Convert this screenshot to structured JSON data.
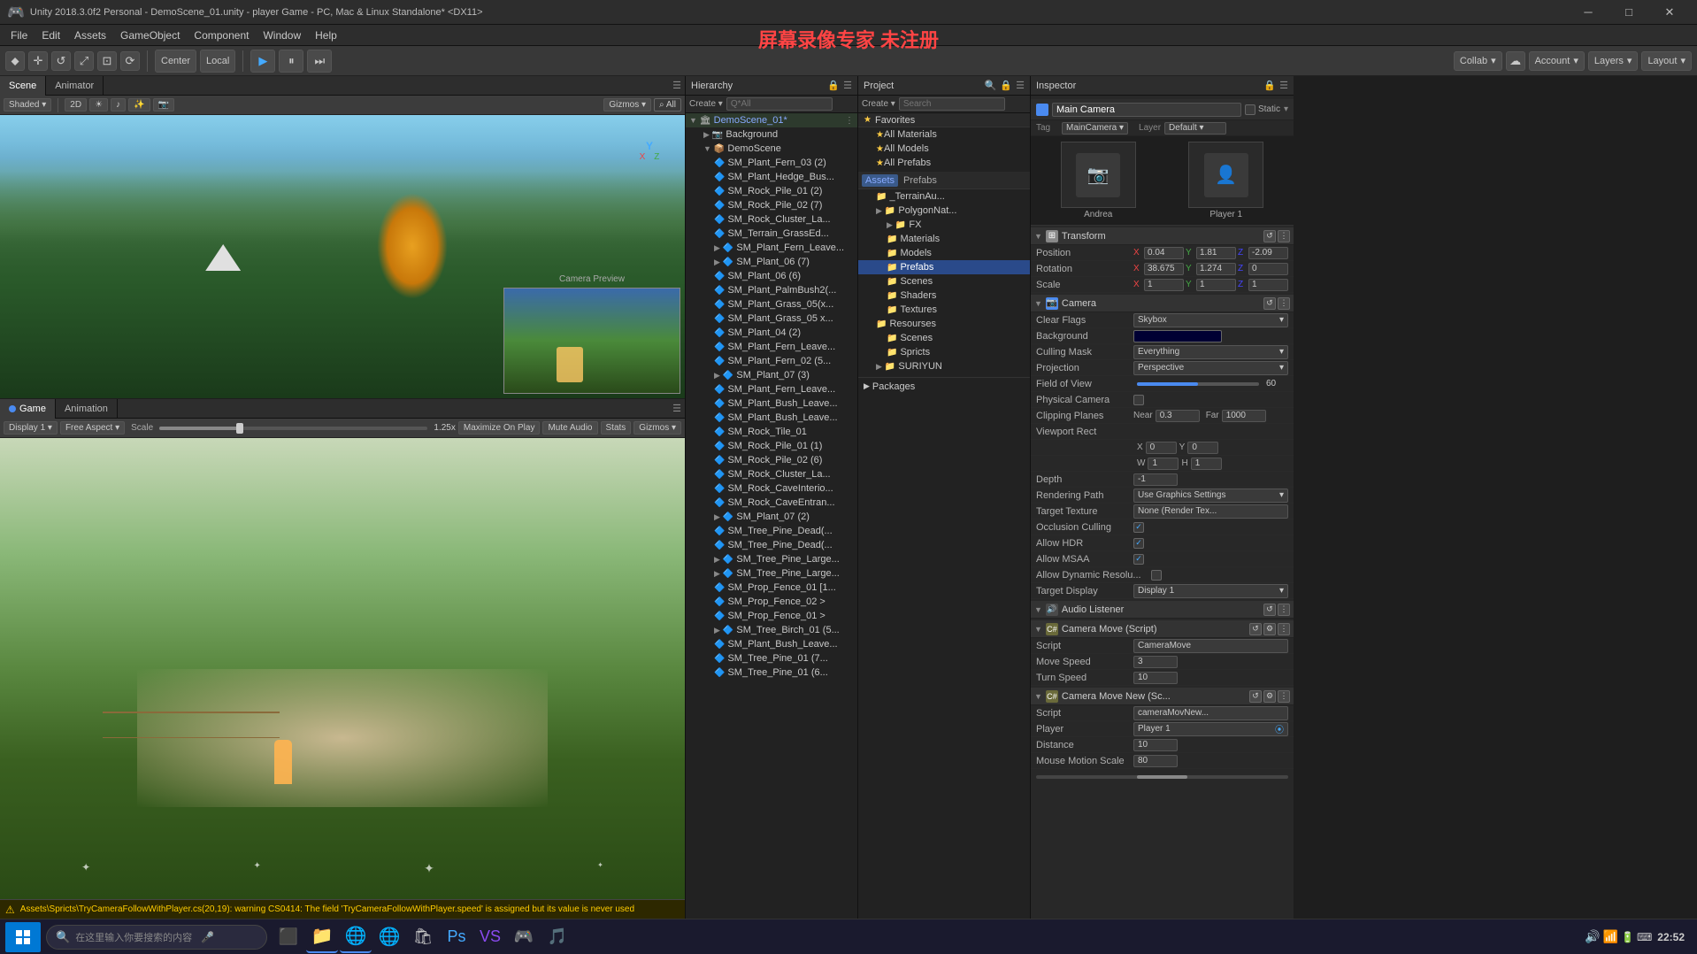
{
  "titlebar": {
    "title": "Unity 2018.3.0f2 Personal - DemoScene_01.unity - player Game - PC, Mac & Linux Standalone* <DX11>",
    "icon": "🎮"
  },
  "watermark": "屏幕录像专家 未注册",
  "menubar": {
    "items": [
      "File",
      "Edit",
      "Assets",
      "GameObject",
      "Component",
      "Window",
      "Help"
    ]
  },
  "toolbar": {
    "transform_tools": [
      "⬥",
      "+",
      "↺",
      "⤢",
      "⊡",
      "⟳"
    ],
    "pivot": "Center",
    "space": "Local",
    "play": "▶",
    "pause": "⏸",
    "step": "⏭",
    "collab": "Collab",
    "account": "Account",
    "layers": "Layers",
    "layout": "Layout"
  },
  "scene": {
    "tabs": [
      "Scene",
      "Animator"
    ],
    "mode": "Shaded",
    "is2d": "2D",
    "gizmos": "Gizmos",
    "search": "All"
  },
  "game": {
    "tabs": [
      "Game",
      "Animation"
    ],
    "display": "Display 1",
    "aspect": "Free Aspect",
    "scale_label": "Scale",
    "scale_value": "1.25x",
    "maximize": "Maximize On Play",
    "mute": "Mute Audio",
    "stats": "Stats",
    "gizmos": "Gizmos"
  },
  "hierarchy": {
    "title": "Hierarchy",
    "create_label": "Create",
    "search_placeholder": "Q*All",
    "items": [
      {
        "label": "Background",
        "level": 0,
        "arrow": "▶",
        "has_arrow": true
      },
      {
        "label": "DemoScene",
        "level": 0,
        "arrow": "▼",
        "has_arrow": true,
        "expanded": true
      },
      {
        "label": "SM_Plant_Fern_03 (2)",
        "level": 1,
        "has_arrow": false
      },
      {
        "label": "SM_Plant_Hedge_Bus...",
        "level": 1,
        "has_arrow": false
      },
      {
        "label": "SM_Rock_Pile_01 (2)",
        "level": 1,
        "has_arrow": false
      },
      {
        "label": "SM_Rock_Pile_02 (7)",
        "level": 1,
        "has_arrow": false
      },
      {
        "label": "SM_Rock_Cluster_La...",
        "level": 1,
        "has_arrow": false
      },
      {
        "label": "SM_Terrain_GrassEd...",
        "level": 1,
        "has_arrow": false
      },
      {
        "label": "SM_Plant_Fern_Leave...",
        "level": 1,
        "has_arrow": true,
        "arrow": "▶"
      },
      {
        "label": "SM_Plant_06 (7)",
        "level": 1,
        "has_arrow": true,
        "arrow": "▶"
      },
      {
        "label": "SM_Plant_06 (6)",
        "level": 1,
        "has_arrow": false
      },
      {
        "label": "SM_Plant_PalmBush2(...",
        "level": 1,
        "has_arrow": false
      },
      {
        "label": "SM_Plant_Grass_05(x...",
        "level": 1,
        "has_arrow": false
      },
      {
        "label": "SM_Plant_Grass_05 x...",
        "level": 1,
        "has_arrow": false
      },
      {
        "label": "SM_Plant_04 (2)",
        "level": 1,
        "has_arrow": false
      },
      {
        "label": "SM_Plant_Fern_Leave...",
        "level": 1,
        "has_arrow": false
      },
      {
        "label": "SM_Plant_Fern_02 (5...",
        "level": 1,
        "has_arrow": false
      },
      {
        "label": "SM_Plant_07 (3)",
        "level": 1,
        "has_arrow": true,
        "arrow": "▶"
      },
      {
        "label": "SM_Plant_Fern_Leave...",
        "level": 1,
        "has_arrow": false
      },
      {
        "label": "SM_Plant_Bush_Leave...",
        "level": 1,
        "has_arrow": false
      },
      {
        "label": "SM_Plant_Bush_Leave...",
        "level": 1,
        "has_arrow": false
      },
      {
        "label": "SM_Rock_Tile_01",
        "level": 1,
        "has_arrow": false
      },
      {
        "label": "SM_Rock_Pile_01 (1)",
        "level": 1,
        "has_arrow": false
      },
      {
        "label": "SM_Rock_Pile_02 (6)",
        "level": 1,
        "has_arrow": false
      },
      {
        "label": "SM_Rock_Cluster_La...",
        "level": 1,
        "has_arrow": false
      },
      {
        "label": "SM_Rock_CaveInterio...",
        "level": 1,
        "has_arrow": false
      },
      {
        "label": "SM_Rock_CaveEntran...",
        "level": 1,
        "has_arrow": false
      },
      {
        "label": "SM_Plant_07 (2)",
        "level": 1,
        "has_arrow": true,
        "arrow": "▶"
      },
      {
        "label": "SM_Tree_Pine_Dead(...",
        "level": 1,
        "has_arrow": false
      },
      {
        "label": "SM_Tree_Pine_Dead(...",
        "level": 1,
        "has_arrow": false
      },
      {
        "label": "SM_Tree_Pine_Large...",
        "level": 1,
        "has_arrow": true,
        "arrow": "▶"
      },
      {
        "label": "SM_Tree_Pine_Large...",
        "level": 1,
        "has_arrow": true,
        "arrow": "▶"
      },
      {
        "label": "SM_Prop_Fence_01 [1...",
        "level": 1,
        "has_arrow": false
      },
      {
        "label": "SM_Prop_Fence_02 >",
        "level": 1,
        "has_arrow": false
      },
      {
        "label": "SM_Prop_Fence_01 >",
        "level": 1,
        "has_arrow": false
      },
      {
        "label": "SM_Tree_Birch_01 (5...",
        "level": 1,
        "has_arrow": true,
        "arrow": "▶"
      },
      {
        "label": "SM_Plant_Bush_Leave...",
        "level": 1,
        "has_arrow": false
      },
      {
        "label": "SM_Tree_Pine_01 (7...",
        "level": 1,
        "has_arrow": false
      },
      {
        "label": "SM_Tree_Pine_01 (6...",
        "level": 1,
        "has_arrow": false
      }
    ]
  },
  "project": {
    "title": "Project",
    "favorites_label": "Favorites",
    "assets_label": "Assets",
    "packages_label": "Packages",
    "favorites": [
      {
        "label": "All Materials"
      },
      {
        "label": "All Models"
      },
      {
        "label": "All Prefabs"
      }
    ],
    "assets": [
      {
        "label": "_TerrainAu..."
      },
      {
        "label": "PolygonNat..."
      },
      {
        "label": "FX",
        "arrow": "▶"
      },
      {
        "label": "Materials"
      },
      {
        "label": "Models"
      },
      {
        "label": "Prefabs",
        "selected": true
      },
      {
        "label": "Scenes"
      },
      {
        "label": "Shaders"
      },
      {
        "label": "Textures"
      },
      {
        "label": "Resourses"
      },
      {
        "label": "Scenes"
      },
      {
        "label": "Spricts"
      },
      {
        "label": "SURIYUN"
      }
    ]
  },
  "inspector": {
    "title": "Inspector",
    "object_name": "Main Camera",
    "static_label": "Static",
    "tag_label": "Tag",
    "tag_value": "MainCamera",
    "layer_label": "Layer",
    "layer_value": "Default",
    "avatars": [
      {
        "label": "Andrea"
      },
      {
        "label": "Player 1"
      }
    ],
    "transform": {
      "title": "Transform",
      "position": {
        "label": "Position",
        "x": "0.04",
        "y": "1.81",
        "z": "-2.09"
      },
      "rotation": {
        "label": "Rotation",
        "x": "38.675",
        "y": "1.274",
        "z": "0"
      },
      "scale": {
        "label": "Scale",
        "x": "1",
        "y": "1",
        "z": "1"
      }
    },
    "camera": {
      "title": "Camera",
      "clear_flags_label": "Clear Flags",
      "clear_flags_value": "Skybox",
      "background_label": "Background",
      "culling_mask_label": "Culling Mask",
      "culling_mask_value": "Everything",
      "projection_label": "Projection",
      "projection_value": "Perspective",
      "fov_label": "Field of View",
      "fov_value": "60",
      "fov_slider_pct": 50,
      "physical_camera_label": "Physical Camera",
      "clipping_label": "Clipping Planes",
      "near_label": "Near",
      "near_value": "0.3",
      "far_label": "Far",
      "far_value": "1000",
      "viewport_label": "Viewport Rect",
      "vp_x": "0",
      "vp_y": "0",
      "vp_w": "1",
      "vp_h": "1",
      "depth_label": "Depth",
      "depth_value": "-1",
      "rendering_path_label": "Rendering Path",
      "rendering_path_value": "Use Graphics Settings",
      "target_texture_label": "Target Texture",
      "target_texture_value": "None (Render Tex...",
      "occlusion_label": "Occlusion Culling",
      "occlusion_checked": true,
      "allow_hdr_label": "Allow HDR",
      "allow_hdr_checked": true,
      "allow_msaa_label": "Allow MSAA",
      "allow_msaa_checked": true,
      "allow_dynres_label": "Allow Dynamic Resolu...",
      "allow_dynres_checked": false,
      "target_display_label": "Target Display",
      "target_display_value": "Display 1"
    },
    "audio_listener": {
      "title": "Audio Listener"
    },
    "camera_move": {
      "title": "Camera Move (Script)",
      "script_label": "Script",
      "script_value": "CameraMove",
      "move_speed_label": "Move Speed",
      "move_speed_value": "3",
      "turn_speed_label": "Turn Speed",
      "turn_speed_value": "10"
    },
    "camera_move_new": {
      "title": "Camera Move New (Sc...",
      "script_label": "Script",
      "script_value": "cameraMovNew...",
      "player_label": "Player",
      "player_value": "Player 1",
      "distance_label": "Distance",
      "distance_value": "10",
      "mouse_motion_label": "Mouse Motion Scale",
      "mouse_motion_value": "80"
    }
  },
  "warning": {
    "text": "Assets\\Spricts\\TryCameraFollowWithPlayer.cs(20,19): warning CS0414: The field 'TryCameraFollowWithPlayer.speed' is assigned but its value is never used"
  },
  "taskbar": {
    "time": "22:52",
    "search_placeholder": "在这里输入你要搜索的内容"
  }
}
